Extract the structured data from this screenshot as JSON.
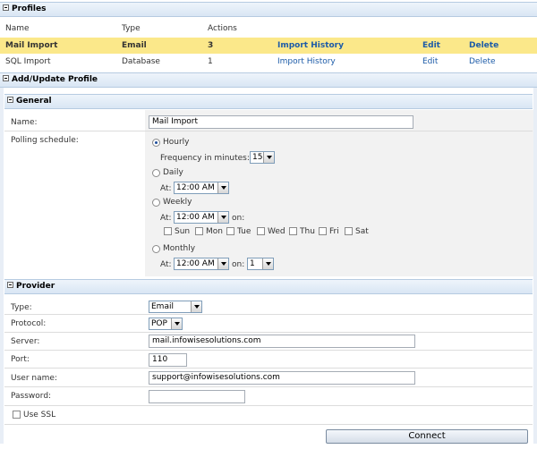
{
  "profiles": {
    "header": "Profiles",
    "columns": [
      "Name",
      "Type",
      "Actions"
    ],
    "rows": [
      {
        "name": "Mail Import",
        "type": "Email",
        "count": "3",
        "history": "Import History",
        "edit": "Edit",
        "delete": "Delete"
      },
      {
        "name": "SQL Import",
        "type": "Database",
        "count": "1",
        "history": "Import History",
        "edit": "Edit",
        "delete": "Delete"
      }
    ]
  },
  "add_update": {
    "header": "Add/Update Profile"
  },
  "general": {
    "header": "General",
    "name_label": "Name:",
    "name_value": "Mail Import",
    "polling_label": "Polling schedule:",
    "hourly": "Hourly",
    "frequency_label": "Frequency in minutes:",
    "frequency_value": "15",
    "daily": "Daily",
    "at_label": "At:",
    "time_value": "12:00 AM",
    "weekly": "Weekly",
    "on_label": "on:",
    "days": [
      "Sun",
      "Mon",
      "Tue",
      "Wed",
      "Thu",
      "Fri",
      "Sat"
    ],
    "monthly": "Monthly",
    "month_day_value": "1"
  },
  "provider": {
    "header": "Provider",
    "type_label": "Type:",
    "type_value": "Email",
    "protocol_label": "Protocol:",
    "protocol_value": "POP",
    "server_label": "Server:",
    "server_value": "mail.infowisesolutions.com",
    "port_label": "Port:",
    "port_value": "110",
    "username_label": "User name:",
    "username_value": "support@infowisesolutions.com",
    "password_label": "Password:",
    "password_value": "",
    "ssl_label": "Use SSL"
  },
  "connect_button": "Connect"
}
